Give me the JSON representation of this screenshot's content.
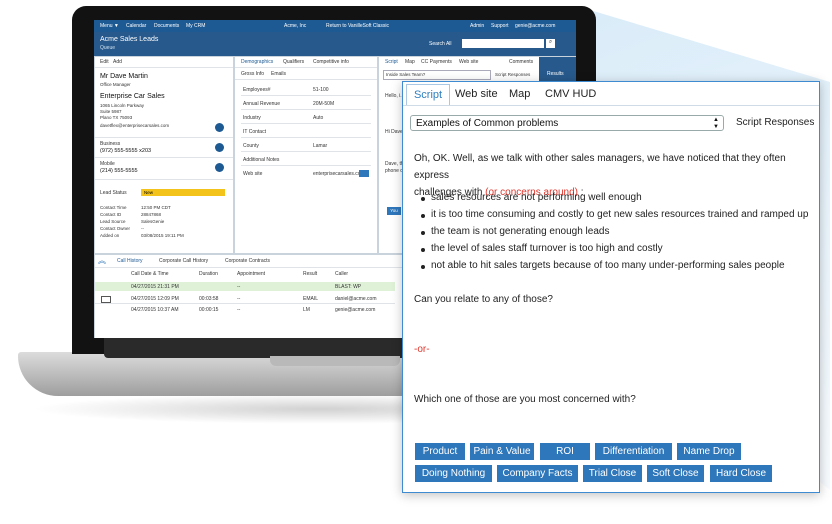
{
  "crm": {
    "topbar": {
      "menu": "Menu ▼",
      "calendar": "Calendar",
      "documents": "Documents",
      "my_crm": "My CRM",
      "company": "Acme, Inc",
      "return_link": "Return to VanilleSoft Classic",
      "admin": "Admin",
      "support": "Support",
      "user": "genie@acme.com"
    },
    "header": {
      "title": "Acme Sales Leads",
      "subtitle": "Queue",
      "search_label": "Search All"
    },
    "contact": {
      "edit": "Edit",
      "add": "Add",
      "name": "Mr Dave Martin",
      "role": "Office Manager",
      "company": "Enterprise Car Sales",
      "address1": "1065 Lincoln Parkway",
      "address2": "Suite 5987",
      "city": "Plano  TX  75093",
      "email": "davetflex@enterprisecarsales.com",
      "business_label": "Business",
      "business_phone": "(972) 555-5555 x203",
      "mobile_label": "Mobile",
      "mobile_phone": "(214) 555-5555"
    },
    "lead": {
      "status_label": "Lead Status",
      "status_value": "New",
      "fields": [
        [
          "Contact Time",
          "12:50 PM CDT"
        ],
        [
          "Contact ID",
          "28847868"
        ],
        [
          "Lead Source",
          "SalesGenie"
        ],
        [
          "Contact Owner",
          "--"
        ],
        [
          "Added on",
          "03/08/2015 19:11 PM"
        ]
      ]
    },
    "mid_tabs": [
      "Demographics",
      "Qualifiers",
      "Competitive info"
    ],
    "mid_subtabs": [
      "Gross Info",
      "Emails"
    ],
    "demographics": [
      [
        "Employees#",
        "51-100"
      ],
      [
        "Annual Revenue",
        "20M-50M"
      ],
      [
        "Industry",
        "Auto"
      ],
      [
        "IT Contact",
        ""
      ],
      [
        "County",
        "Lamar"
      ],
      [
        "Additional Notes",
        ""
      ],
      [
        "Web site",
        "enterprisecarsales.com"
      ]
    ],
    "right_tabs": [
      "Script",
      "Map",
      "CC Payments",
      "Web site",
      "Comments"
    ],
    "right_sub": "Inside Sales Team?",
    "right_sub_btn": "Script Responses",
    "right_lines": [
      "Hello, i...",
      "Hi Dave...",
      "Dave, th...",
      "phone c..."
    ],
    "right_btn": "You",
    "results": "Results",
    "history_tabs": [
      "Call History",
      "Corporate Call History",
      "Corporate Contracts"
    ],
    "history_cols": [
      "Call Date & Time",
      "Duration",
      "Appointment",
      "Result",
      "Caller"
    ],
    "history_rows": [
      [
        "04/27/2015 21:31 PM",
        "",
        "--",
        "",
        "BLAST: WP"
      ],
      [
        "04/27/2015 12:09 PM",
        "00:03:58",
        "--",
        "EMAIL",
        "daniel@acme.com"
      ],
      [
        "04/27/2015 10:37 AM",
        "00:00:15",
        "--",
        "LM",
        "genie@acme.com"
      ]
    ]
  },
  "hud": {
    "tabs": [
      "Script",
      "Web site",
      "Map",
      "CMV HUD"
    ],
    "select_value": "Examples of Common problems",
    "script_responses": "Script Responses",
    "intro_part1": "Oh, OK. Well, as we talk with other sales managers, we have noticed that they often express",
    "intro_part2": "challenges with",
    "intro_red": "(or concerns around)",
    "intro_colon": " :",
    "bullets": [
      "sales resources are not performing well enough",
      "it is too time consuming and costly to get new sales resources trained and ramped up",
      "the team is not generating enough leads",
      "the level of sales staff turnover is too high and costly",
      "not able to hit sales targets because of too many under-performing sales people"
    ],
    "question1": "Can you relate to any of those?",
    "or": "-or-",
    "question2": "Which one of those are you most concerned with?",
    "buttons_row1": [
      "Product",
      "Pain & Value",
      "ROI",
      "Differentiation",
      "Name Drop"
    ],
    "buttons_row2": [
      "Doing Nothing",
      "Company Facts",
      "Trial Close",
      "Soft Close",
      "Hard Close"
    ]
  },
  "colors": {
    "accent": "#2f77bb",
    "red": "#e0352b",
    "crm_blue": "#1d5a94"
  }
}
